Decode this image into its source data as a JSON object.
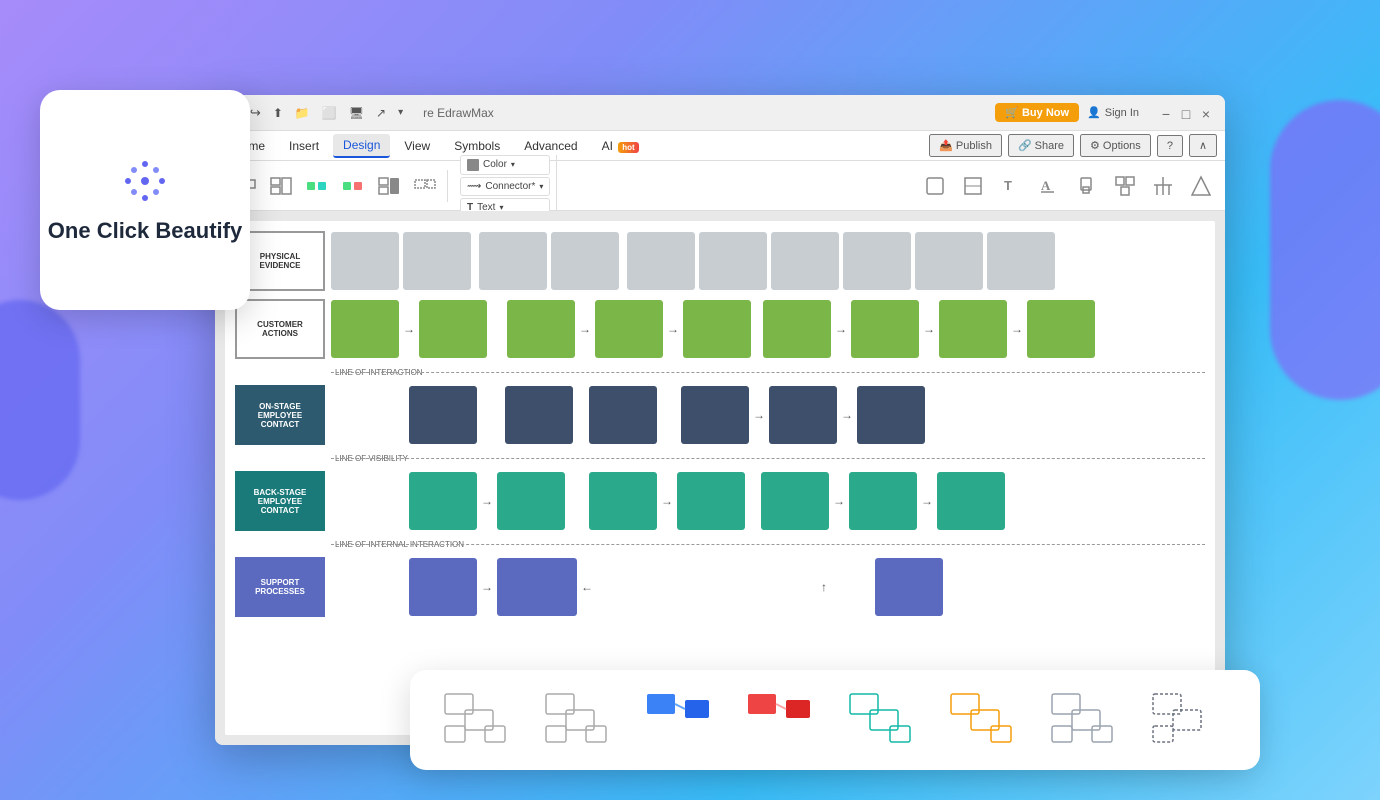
{
  "app": {
    "title": "re EdrawMax",
    "window_controls": [
      "−",
      "□",
      "×"
    ]
  },
  "header": {
    "buy_label": "🛒 Buy Now",
    "sign_in_label": "Sign In",
    "publish_label": "Publish",
    "share_label": "Share",
    "options_label": "Options"
  },
  "menu": {
    "items": [
      "Home",
      "Insert",
      "Design",
      "View",
      "Symbols",
      "Advanced",
      "AI"
    ],
    "active": "Design",
    "ai_badge": "hot"
  },
  "toolbar": {
    "color_label": "Color",
    "connector_label": "Connector*",
    "text_label": "Text"
  },
  "diagram": {
    "rows": [
      {
        "label": "PHYSICAL\nEVIDENCE",
        "label_style": "gray",
        "boxes": [
          {
            "type": "gray",
            "arrow": false
          },
          {
            "type": "gray",
            "arrow": true
          },
          {
            "type": "gray",
            "arrow": false
          },
          {
            "type": "gray",
            "arrow": true
          },
          {
            "type": "gray",
            "arrow": false
          },
          {
            "type": "gray",
            "arrow": false
          },
          {
            "type": "gray",
            "arrow": false
          },
          {
            "type": "gray",
            "arrow": false
          },
          {
            "type": "gray",
            "arrow": false
          },
          {
            "type": "gray",
            "arrow": false
          }
        ]
      },
      {
        "label": "CUSTOMER\nACTIONS",
        "label_style": "gray",
        "boxes": [
          {
            "type": "green",
            "arrow": true
          },
          {
            "type": "green",
            "arrow": false
          },
          {
            "type": "green",
            "arrow": true
          },
          {
            "type": "green",
            "arrow": false
          },
          {
            "type": "green",
            "arrow": true
          },
          {
            "type": "green",
            "arrow": false
          },
          {
            "type": "green",
            "arrow": true
          },
          {
            "type": "green",
            "arrow": false
          },
          {
            "type": "green",
            "arrow": true
          },
          {
            "type": "green",
            "arrow": false
          }
        ]
      },
      {
        "separator": "LINE OF INTERACTION"
      },
      {
        "label": "ON-STAGE\nEMPLOYEE\nCONTACT",
        "label_style": "dark-teal",
        "boxes": [
          {
            "type": "dark-blue",
            "arrow": false
          },
          {
            "type": "dark-blue",
            "arrow": false
          },
          {
            "type": "dark-blue",
            "arrow": false
          },
          {
            "type": "dark-blue",
            "arrow": false
          },
          {
            "type": "dark-blue",
            "arrow": true
          },
          {
            "type": "dark-blue",
            "arrow": false
          },
          {
            "type": "dark-blue",
            "arrow": true
          },
          {
            "type": "dark-blue",
            "arrow": false
          }
        ]
      },
      {
        "separator": "LINE OF VISIBILITY"
      },
      {
        "label": "BACK-STAGE\nEMPLOYEE\nCONTACT",
        "label_style": "teal",
        "boxes": [
          {
            "type": "teal",
            "arrow": true
          },
          {
            "type": "teal",
            "arrow": false
          },
          {
            "type": "teal",
            "arrow": false
          },
          {
            "type": "teal",
            "arrow": true
          },
          {
            "type": "teal",
            "arrow": false
          },
          {
            "type": "teal",
            "arrow": true
          },
          {
            "type": "teal",
            "arrow": false
          },
          {
            "type": "teal",
            "arrow": true
          },
          {
            "type": "teal",
            "arrow": false
          }
        ]
      },
      {
        "separator": "LINE OF INTERNAL INTERACTION"
      },
      {
        "label": "SUPPORT\nPROCESSES",
        "label_style": "purple",
        "boxes": [
          {
            "type": "purple",
            "arrow": true
          },
          {
            "type": "purple",
            "arrow": false
          },
          {
            "type": "purple",
            "arrow": false
          },
          {
            "type": "purple",
            "arrow": false
          },
          {
            "type": "purple",
            "arrow": false
          },
          {
            "type": "purple",
            "arrow": true
          },
          {
            "type": "purple",
            "arrow": false
          }
        ]
      }
    ],
    "separators": {
      "line1": "LINE OF INTERACTION",
      "line2": "LINE OF VISIBILITY",
      "line3": "LINE OF INTERNAL INTERACTION"
    }
  },
  "shapes": {
    "templates": [
      {
        "id": "t1",
        "color": "none"
      },
      {
        "id": "t2",
        "color": "none"
      },
      {
        "id": "t3",
        "color": "blue"
      },
      {
        "id": "t4",
        "color": "red"
      },
      {
        "id": "t5",
        "color": "teal"
      },
      {
        "id": "t6",
        "color": "yellow"
      },
      {
        "id": "t7",
        "color": "gray"
      },
      {
        "id": "t8",
        "color": "green-gray"
      }
    ]
  },
  "ocb": {
    "title": "One Click\nBeautify",
    "icon": "✳"
  }
}
